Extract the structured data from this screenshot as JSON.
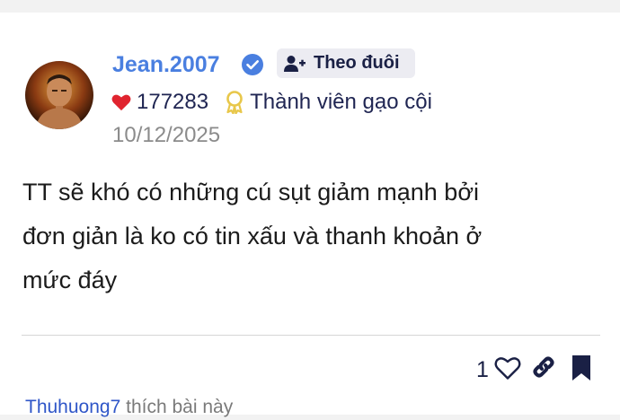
{
  "post": {
    "author": {
      "username": "Jean.2007",
      "verified": true,
      "avatar_icon": "avatar-photo"
    },
    "follow_label": "Theo đuôi",
    "stats": {
      "likes_total": "177283",
      "rank_label": "Thành viên gạo cội"
    },
    "date": "10/12/2025",
    "content_lines": [
      "TT sẽ khó có những cú sụt giảm mạnh bởi",
      "đơn giản là ko có tin xấu và thanh khoản ở",
      "mức đáy"
    ],
    "actions": {
      "like_count": "1",
      "icons": [
        "heart-outline-icon",
        "link-icon",
        "bookmark-icon"
      ]
    },
    "footer": {
      "liker_name": "Thuhuong7",
      "liker_suffix": "thích bài này"
    }
  },
  "colors": {
    "accent": "#4a7fe0",
    "heart": "#e0242f",
    "medal": "#e8c74a",
    "text_dark": "#1a2045",
    "link": "#2f56c8"
  }
}
